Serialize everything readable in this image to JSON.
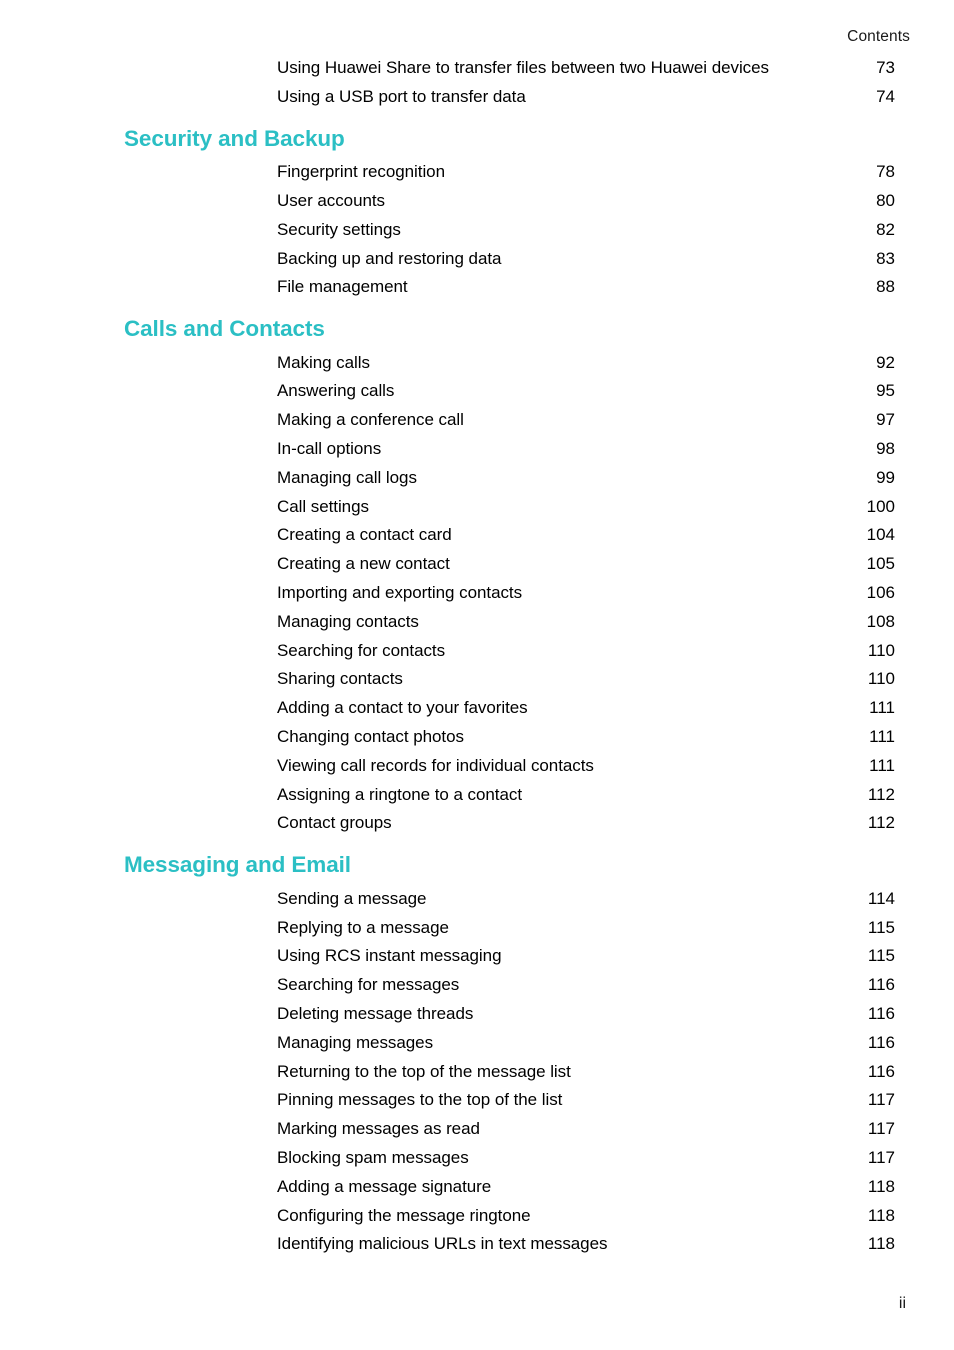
{
  "header": {
    "running_title": "Contents"
  },
  "footer": {
    "folio": "ii"
  },
  "theme": {
    "heading_color": "#2BBFC4",
    "text_color": "#000000",
    "background": "#FFFFFF"
  },
  "toc": {
    "groups": [
      {
        "heading": null,
        "entries": [
          {
            "title": "Using Huawei Share to transfer files between two Huawei devices",
            "page": "73"
          },
          {
            "title": "Using a USB port to transfer data",
            "page": "74"
          }
        ]
      },
      {
        "heading": "Security and Backup",
        "entries": [
          {
            "title": "Fingerprint recognition",
            "page": "78"
          },
          {
            "title": "User accounts",
            "page": "80"
          },
          {
            "title": "Security settings",
            "page": "82"
          },
          {
            "title": "Backing up and restoring data",
            "page": "83"
          },
          {
            "title": "File management",
            "page": "88"
          }
        ]
      },
      {
        "heading": "Calls and Contacts",
        "entries": [
          {
            "title": "Making calls",
            "page": "92"
          },
          {
            "title": "Answering calls",
            "page": "95"
          },
          {
            "title": "Making a conference call",
            "page": "97"
          },
          {
            "title": "In-call options",
            "page": "98"
          },
          {
            "title": "Managing call logs",
            "page": "99"
          },
          {
            "title": "Call settings",
            "page": "100"
          },
          {
            "title": "Creating a contact card",
            "page": "104"
          },
          {
            "title": "Creating a new contact",
            "page": "105"
          },
          {
            "title": "Importing and exporting contacts",
            "page": "106"
          },
          {
            "title": "Managing contacts",
            "page": "108"
          },
          {
            "title": "Searching for contacts",
            "page": "110"
          },
          {
            "title": "Sharing contacts",
            "page": "110"
          },
          {
            "title": "Adding a contact to your favorites",
            "page": "111"
          },
          {
            "title": "Changing contact photos",
            "page": "111"
          },
          {
            "title": "Viewing call records for individual contacts",
            "page": "111"
          },
          {
            "title": "Assigning a ringtone to a contact",
            "page": "112"
          },
          {
            "title": "Contact groups",
            "page": "112"
          }
        ]
      },
      {
        "heading": "Messaging and Email",
        "entries": [
          {
            "title": "Sending a message",
            "page": "114"
          },
          {
            "title": "Replying to a message",
            "page": "115"
          },
          {
            "title": "Using RCS instant messaging",
            "page": "115"
          },
          {
            "title": "Searching for messages",
            "page": "116"
          },
          {
            "title": "Deleting message threads",
            "page": "116"
          },
          {
            "title": "Managing messages",
            "page": "116"
          },
          {
            "title": "Returning to the top of the message list",
            "page": "116"
          },
          {
            "title": "Pinning messages to the top of the list",
            "page": "117"
          },
          {
            "title": "Marking messages as read",
            "page": "117"
          },
          {
            "title": "Blocking spam messages",
            "page": "117"
          },
          {
            "title": "Adding a message signature",
            "page": "118"
          },
          {
            "title": "Configuring the message ringtone",
            "page": "118"
          },
          {
            "title": "Identifying malicious URLs in text messages",
            "page": "118"
          }
        ]
      }
    ]
  }
}
